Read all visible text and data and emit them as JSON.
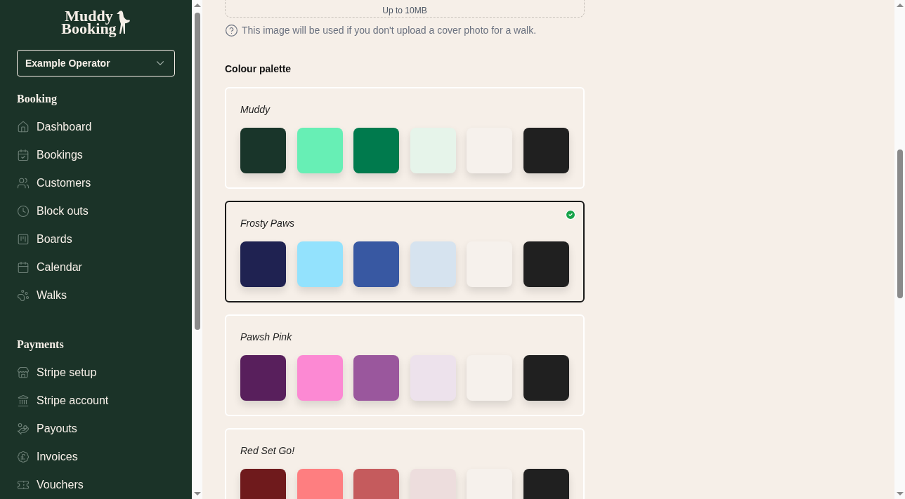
{
  "sidebar": {
    "logo": {
      "line_1": "Muddy",
      "line_2": "Booking"
    },
    "operator_select": {
      "value": "Example Operator"
    },
    "sections": [
      {
        "title": "Booking",
        "items": [
          {
            "kind": "home",
            "label": "Dashboard"
          },
          {
            "kind": "calendar-check",
            "label": "Bookings"
          },
          {
            "kind": "users",
            "label": "Customers"
          },
          {
            "kind": "clock",
            "label": "Block outs"
          },
          {
            "kind": "board",
            "label": "Boards"
          },
          {
            "kind": "calendar",
            "label": "Calendar"
          },
          {
            "kind": "paw",
            "label": "Walks"
          }
        ]
      },
      {
        "title": "Payments",
        "items": [
          {
            "kind": "store",
            "label": "Stripe setup"
          },
          {
            "kind": "bank",
            "label": "Stripe account"
          },
          {
            "kind": "hand-coins",
            "label": "Payouts"
          },
          {
            "kind": "pound",
            "label": "Invoices"
          },
          {
            "kind": "ticket",
            "label": "Vouchers"
          }
        ]
      }
    ]
  },
  "upload": {
    "hint": "Up to 10MB",
    "help_text": "This image will be used if you don't upload a cover photo for a walk."
  },
  "colour_palette": {
    "label": "Colour palette",
    "palettes": [
      {
        "name": "Muddy",
        "selected": false,
        "swatches": [
          {
            "color": "#19352a"
          },
          {
            "color": "#67efb5"
          },
          {
            "color": "#007a4d"
          },
          {
            "color": "#e6f4ea"
          },
          {
            "color": "#f6f1ec"
          },
          {
            "color": "#202020"
          }
        ]
      },
      {
        "name": "Frosty Paws",
        "selected": true,
        "swatches": [
          {
            "color": "#1f2251"
          },
          {
            "color": "#93e2fd"
          },
          {
            "color": "#3858a2"
          },
          {
            "color": "#d6e3ef"
          },
          {
            "color": "#f6f1ec"
          },
          {
            "color": "#202020"
          }
        ]
      },
      {
        "name": "Pawsh Pink",
        "selected": false,
        "swatches": [
          {
            "color": "#581f5c"
          },
          {
            "color": "#fc89d3"
          },
          {
            "color": "#9a579d"
          },
          {
            "color": "#ede2ec"
          },
          {
            "color": "#f6f1ec"
          },
          {
            "color": "#202020"
          }
        ]
      },
      {
        "name": "Red Set Go!",
        "selected": false,
        "swatches": [
          {
            "color": "#6f1a1c"
          },
          {
            "color": "#fe7e80"
          },
          {
            "color": "#c55b5d"
          },
          {
            "color": "#eddddd"
          },
          {
            "color": "#f6f1ec"
          },
          {
            "color": "#202020"
          }
        ]
      }
    ]
  }
}
